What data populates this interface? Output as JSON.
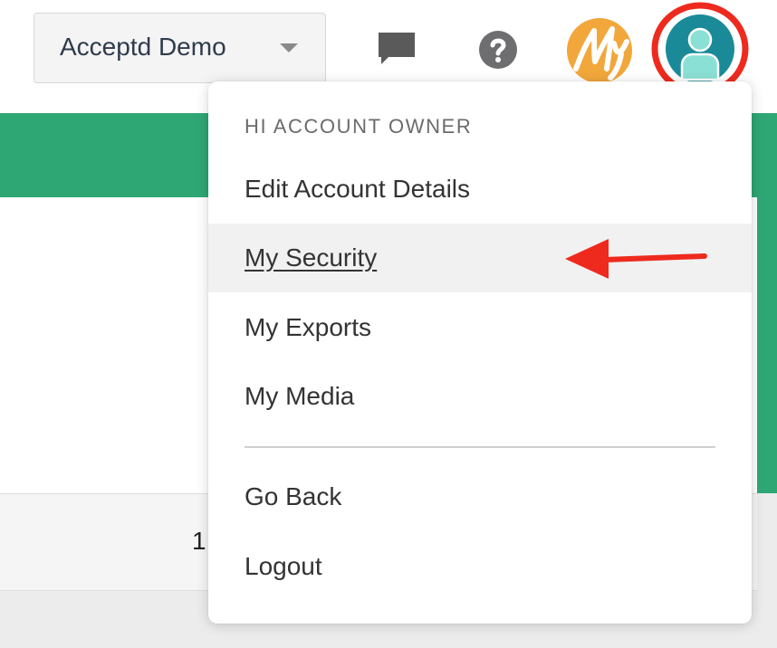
{
  "header": {
    "account_selector": {
      "label": "Acceptd Demo"
    },
    "icons": {
      "chat": "chat-icon",
      "help": "help-icon",
      "brand": "brand-logo",
      "profile": "user-avatar-icon"
    },
    "brand_logo_text": "My"
  },
  "background": {
    "row_number_partial": "1"
  },
  "account_menu": {
    "header": "HI ACCOUNT OWNER",
    "items": [
      {
        "label": "Edit Account Details"
      },
      {
        "label": "My Security",
        "active": true
      },
      {
        "label": "My Exports"
      },
      {
        "label": "My Media"
      },
      {
        "label": "Go Back"
      },
      {
        "label": "Logout"
      }
    ]
  },
  "colors": {
    "brand_green": "#2fa774",
    "avatar_teal": "#1b8a98",
    "annotation_red": "#ee2a1e",
    "logo_orange": "#f2a73b"
  }
}
